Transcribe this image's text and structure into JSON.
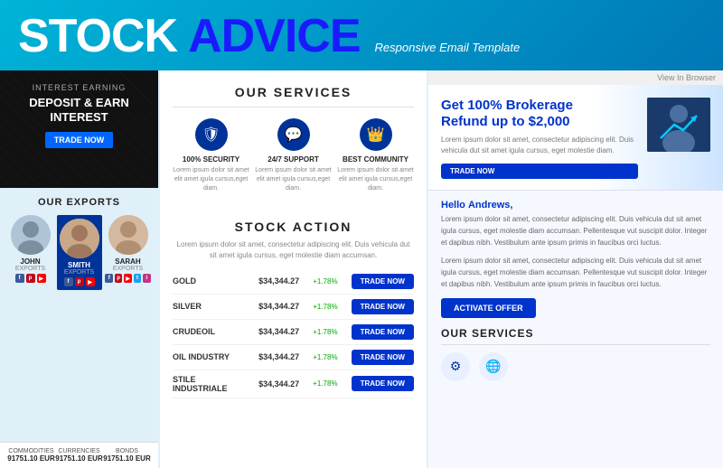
{
  "header": {
    "title_stock": "STOCK",
    "title_advice": "ADVICE",
    "subtitle": "Responsive Email Template"
  },
  "left_panel": {
    "banner": {
      "subtitle": "Interest Earning",
      "title": "DEPOSIT & EARN INTEREST",
      "trade_btn": "TRADE NOW"
    },
    "exports": {
      "section_title": "OUR EXPORTS",
      "people": [
        {
          "name": "JOHN",
          "label": "EXPORTS"
        },
        {
          "name": "SMITH",
          "label": "EXPORTS"
        },
        {
          "name": "SARAH",
          "label": "EXPORTS"
        }
      ]
    },
    "commodities": [
      {
        "label": "COMMODITIES",
        "value": "91751.10 EUR"
      },
      {
        "label": "CURRENCIES",
        "value": "91751.10 EUR"
      },
      {
        "label": "BONDS",
        "value": "91751.10 EUR"
      }
    ]
  },
  "middle_panel": {
    "services": {
      "title": "OUR SERVICES",
      "items": [
        {
          "name": "100% SECURITY",
          "icon": "🛡",
          "desc": "Lorem ipsum dolor sit amet elit amet igula cursus,eget diam."
        },
        {
          "name": "24/7 SUPPORT",
          "icon": "💬",
          "desc": "Lorem ipsum dolor sit amet elit amet igula cursus,eget diam."
        },
        {
          "name": "BEST COMMUNITY",
          "icon": "👑",
          "desc": "Lorem ipsum dolor sit amet elit amet igula cursus,eget diam."
        }
      ]
    },
    "stock_action": {
      "title": "STOCK ACTION",
      "desc": "Lorem ipsum dolor sit amet, consectetur adipiscing elit. Duis vehicula dut sit amet igula cursus, eget molestie diam accumsan.",
      "rows": [
        {
          "name": "GOLD",
          "price": "$34,344.27",
          "change": "+1.78%",
          "btn": "TRADE NOW"
        },
        {
          "name": "SILVER",
          "price": "$34,344.27",
          "change": "+1.78%",
          "btn": "TRADE NOW"
        },
        {
          "name": "CRUDEOIL",
          "price": "$34,344.27",
          "change": "+1.78%",
          "btn": "TRADE NOW"
        },
        {
          "name": "OIL INDUSTRY",
          "price": "$34,344.27",
          "change": "+1.78%",
          "btn": "TRADE NOW"
        },
        {
          "name": "STILE INDUSTRIALE",
          "price": "$34,344.27",
          "change": "+1.78%",
          "btn": "TRADE NOW"
        }
      ]
    }
  },
  "right_panel": {
    "view_in_browser": "View In Browser",
    "brokerage": {
      "title_prefix": "Get ",
      "title_highlight": "100% Brokerage",
      "title_suffix": "Refund up to $2,000",
      "desc": "Lorem ipsum dolor sit amet, consectetur adipiscing elit. Duis vehicula dut sit amet igula cursus, eget molestie diam.",
      "btn": "TRADE NOW"
    },
    "hello": {
      "greeting": "Hello",
      "name": "Andrews,",
      "body1": "Lorem ipsum dolor sit amet, consectetur adipiscing elit. Duis vehicula dut sit amet igula cursus, eget molestie diam accumsan. Pellentesque vut suscipit dolor. Integer et dapibus nibh. Vestibulum ante ipsum primis in faucibus orci luctus.",
      "body2": "Lorem ipsum dolor sit amet, consectetur adipiscing elit. Duis vehicula dut sit amet igula cursus, eget molestie diam accumsan. Pellentesque vut suscipit dolor. Integer et dapibus nibh. Vestibulum ante ipsum primis in faucibus orci luctus.",
      "activate_btn": "ACTIVATE OFFER"
    },
    "services": {
      "title": "OUR SERVICES",
      "items": [
        {
          "icon": "⚙"
        },
        {
          "icon": "🌐"
        }
      ]
    }
  },
  "colors": {
    "primary_blue": "#0033cc",
    "dark_blue": "#003399",
    "accent_cyan": "#00b4d8",
    "bg_light": "#e0f0f8"
  }
}
